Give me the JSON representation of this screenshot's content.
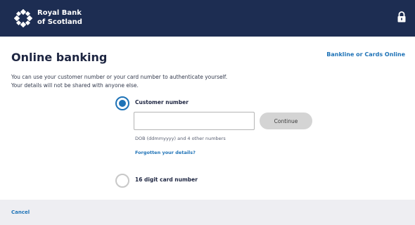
{
  "brand": {
    "line1": "Royal Bank",
    "line2": "of Scotland"
  },
  "page": {
    "title": "Online banking",
    "top_link": "Bankline or Cards Online",
    "intro_line1": "You can use your customer number or your card number to authenticate yourself.",
    "intro_line2": "Your details will not be shared with anyone else."
  },
  "options": {
    "customer_number": {
      "label": "Customer number",
      "selected": true,
      "input_value": "",
      "continue_label": "Continue",
      "hint": "DOB (ddmmyyyy) and 4 other numbers",
      "forgot_link": "Forgotten your details?"
    },
    "card_number": {
      "label": "16 digit card number",
      "selected": false
    }
  },
  "footer": {
    "cancel": "Cancel"
  },
  "colors": {
    "header_bg": "#1d2d52",
    "link_blue": "#1f73b7",
    "button_grey": "#d4d4d4",
    "page_bg": "#eeeef2"
  },
  "icons": {
    "logo": "rbs-daisy-logo-icon",
    "lock": "padlock-icon"
  }
}
